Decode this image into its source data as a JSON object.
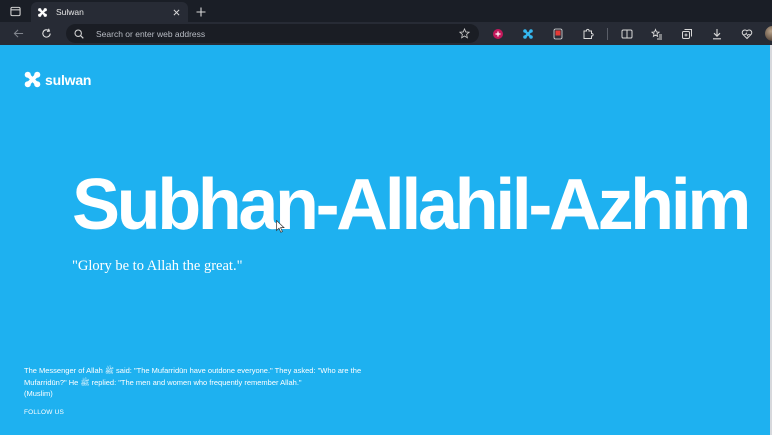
{
  "browser": {
    "tab": {
      "title": "Sulwan"
    },
    "address_bar": {
      "placeholder": "Search or enter web address"
    }
  },
  "page": {
    "brand": {
      "name": "sulwan"
    },
    "hero": {
      "title": "Subhan-Allahil-Azhim",
      "subtitle": "\"Glory be to Allah the great.\""
    },
    "hadith": {
      "text": "The Messenger of Allah ﷺ said: \"The Mufarridūn have outdone everyone.\" They asked: \"Who are the Mufarridūn?\" He ﷺ replied: \"The men and women who frequently remember Allah.\"",
      "source": "(Muslim)"
    },
    "follow_us": "FOLLOW US"
  },
  "colors": {
    "page_bg": "#1eb1f0",
    "chrome_dark": "#1a1e26",
    "toolbar": "#272b35"
  }
}
